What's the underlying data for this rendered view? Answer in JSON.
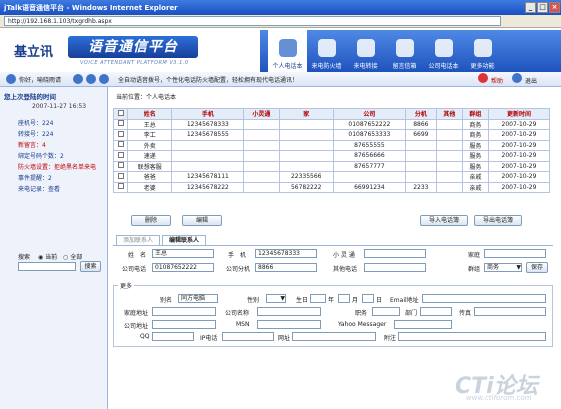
{
  "window": {
    "title": "jTalk语音通信平台 - Windows Internet Explorer",
    "address": "http://192.168.1.103/txgrdhb.aspx"
  },
  "brand": {
    "cn": "基立讯",
    "main": "语音通信平台",
    "sub": "VOICE ATTENDANT PLATFORM V3.1.0"
  },
  "nav": [
    {
      "label": "个人电话本",
      "active": true
    },
    {
      "label": "来电防火墙"
    },
    {
      "label": "来电转接"
    },
    {
      "label": "留言信箱"
    },
    {
      "label": "公司电话本"
    },
    {
      "label": "更多功能"
    }
  ],
  "toolbar": {
    "greeting": "你好，喻晓雨请",
    "marquee": "全自动语音拨号，个性化电话防火墙配置，轻松拥有现代电话通讯！",
    "help": "帮助",
    "logout": "退出"
  },
  "sidebar": {
    "last_login_title": "您上次登陆的时间",
    "last_login_time": "2007-11-27 16:53",
    "lines": [
      {
        "text": "座机号：224",
        "color": "#1a3d8f"
      },
      {
        "text": "转接号：224",
        "color": "#1a3d8f"
      },
      {
        "text": "新留言：4",
        "color": "#c00000"
      },
      {
        "text": "绑定号码个数：2",
        "color": "#1a3d8f"
      },
      {
        "text": "防火墙设置：拒绝黑名单来电",
        "color": "#c00000"
      },
      {
        "text": "事件提醒：2",
        "color": "#1a3d8f"
      },
      {
        "text": "来电记录：查看",
        "color": "#1a3d8f"
      }
    ],
    "search": {
      "label": "搜索",
      "opt_current": "当前",
      "opt_all": "全部",
      "button": "搜索"
    }
  },
  "crumb": "当前位置：个人电话本",
  "table": {
    "headers": [
      "姓名",
      "手机",
      "小灵通",
      "家",
      "公司",
      "分机",
      "其他",
      "群组",
      "更新时间"
    ],
    "rows": [
      [
        "王总",
        "12345678333",
        "",
        "",
        "01087652222",
        "8866",
        "",
        "商务",
        "2007-10-29"
      ],
      [
        "李工",
        "12345678555",
        "",
        "",
        "01087653333",
        "6699",
        "",
        "商务",
        "2007-10-29"
      ],
      [
        "外卖",
        "",
        "",
        "",
        "87655555",
        "",
        "",
        "服务",
        "2007-10-29"
      ],
      [
        "速递",
        "",
        "",
        "",
        "87656666",
        "",
        "",
        "服务",
        "2007-10-29"
      ],
      [
        "联想客服",
        "",
        "",
        "",
        "87657777",
        "",
        "",
        "服务",
        "2007-10-29"
      ],
      [
        "爸爸",
        "12345678111",
        "",
        "22335566",
        "",
        "",
        "",
        "亲戚",
        "2007-10-29"
      ],
      [
        "老婆",
        "12345678222",
        "",
        "56782222",
        "66991234",
        "2233",
        "",
        "亲戚",
        "2007-10-29"
      ]
    ]
  },
  "actions": {
    "delete": "删除",
    "edit": "编辑",
    "import": "导入电话簿",
    "export": "导出电话簿"
  },
  "tabs": {
    "add": "添加联系人",
    "edit": "编辑联系人"
  },
  "form": {
    "name_l": "姓　名",
    "name_v": "王总",
    "mobile_l": "手　机",
    "mobile_v": "12345678333",
    "phs_l": "小 灵 通",
    "home_l": "家庭",
    "company_l": "公司电话",
    "company_v": "01087652222",
    "ext_l": "公司分机",
    "ext_v": "8866",
    "other_l": "其他电话",
    "group_l": "群组",
    "group_v": "商务",
    "save": "保存",
    "more": "更多",
    "alias_l": "别名",
    "alias_v": "同方电脑",
    "gender_l": "性别",
    "birthday_l": "生日",
    "year": "年",
    "month": "月",
    "day": "日",
    "email_l": "Email地址",
    "home_addr_l": "家庭地址",
    "company_name_l": "公司名称",
    "title_l": "职务",
    "dept_l": "部门",
    "fax_l": "传真",
    "company_addr_l": "公司地址",
    "msn_l": "MSN",
    "yahoo_l": "Yahoo Messager",
    "qq_l": "QQ",
    "ipphone_l": "IP电话",
    "web_l": "网址",
    "note_l": "附注"
  },
  "watermark": {
    "main": "CTi论坛",
    "sub": "www.ctiforum.com"
  }
}
